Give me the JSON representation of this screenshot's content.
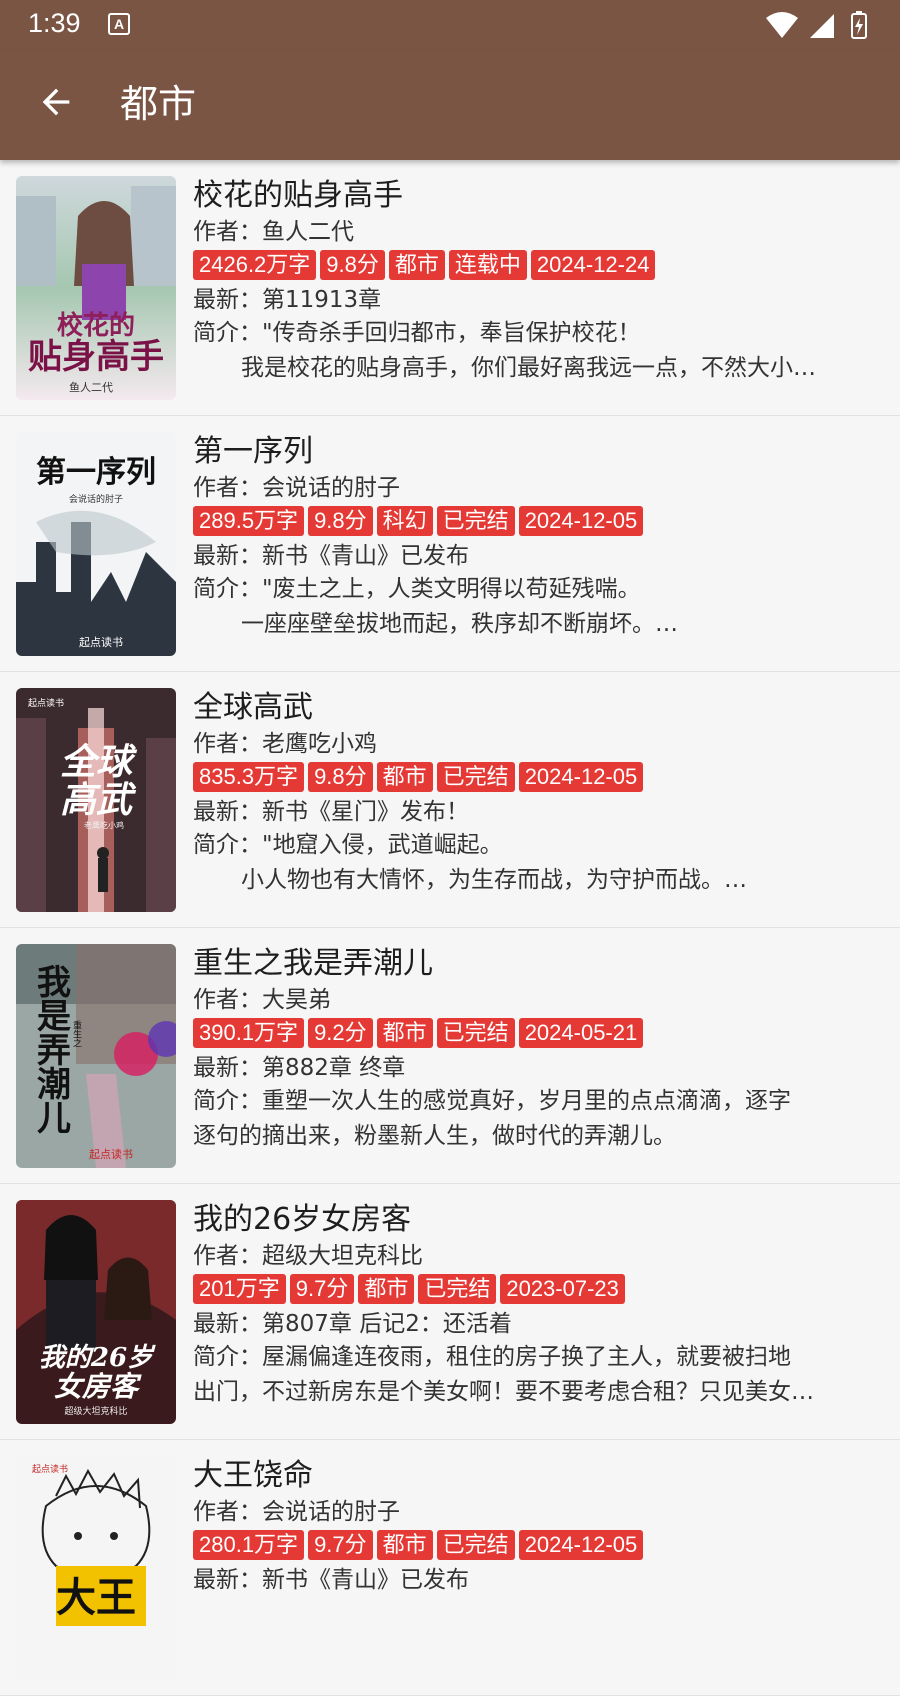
{
  "status_bar": {
    "time": "1:39",
    "notification_glyph": "A"
  },
  "app_bar": {
    "title": "都市",
    "back_icon": "arrow-back-icon"
  },
  "books": [
    {
      "title": "校花的贴身高手",
      "author": "作者：鱼人二代",
      "tags": [
        "2426.2万字",
        "9.8分",
        "都市",
        "连载中",
        "2024-12-24"
      ],
      "latest": "最新：第11913章",
      "desc_line1": "简介：\"传奇杀手回归都市，奉旨保护校花！",
      "desc_line2": "我是校花的贴身高手，你们最好离我远一点，不然大小…",
      "desc_indent": true,
      "cover_text": "校花的贴身高手",
      "cover_author": "鱼人二代"
    },
    {
      "title": "第一序列",
      "author": "作者：会说话的肘子",
      "tags": [
        "289.5万字",
        "9.8分",
        "科幻",
        "已完结",
        "2024-12-05"
      ],
      "latest": "最新：新书《青山》已发布",
      "desc_line1": "简介：\"废土之上，人类文明得以苟延残喘。",
      "desc_line2": "一座座壁垒拔地而起，秩序却不断崩坏。…",
      "desc_indent": true,
      "cover_text": "第一序列",
      "cover_author": "会说话的肘子",
      "cover_publisher": "起点读书"
    },
    {
      "title": "全球高武",
      "author": "作者：老鹰吃小鸡",
      "tags": [
        "835.3万字",
        "9.8分",
        "都市",
        "已完结",
        "2024-12-05"
      ],
      "latest": "最新：新书《星门》发布！",
      "desc_line1": "简介：\"地窟入侵，武道崛起。",
      "desc_line2": "小人物也有大情怀，为生存而战，为守护而战。…",
      "desc_indent": true,
      "cover_text": "全球高武",
      "cover_author": "老鹰吃小鸡",
      "cover_publisher": "起点读书"
    },
    {
      "title": "重生之我是弄潮儿",
      "author": "作者：大昊弟",
      "tags": [
        "390.1万字",
        "9.2分",
        "都市",
        "已完结",
        "2024-05-21"
      ],
      "latest": "最新：第882章 终章",
      "desc_line1": "简介：重塑一次人生的感觉真好，岁月里的点点滴滴，逐字",
      "desc_line2": "逐句的摘出来，粉墨新人生，做时代的弄潮儿。",
      "desc_indent": false,
      "cover_text": "我是弄潮儿",
      "cover_prefix": "重生之",
      "cover_publisher": "起点读书"
    },
    {
      "title": "我的26岁女房客",
      "author": "作者：超级大坦克科比",
      "tags": [
        "201万字",
        "9.7分",
        "都市",
        "已完结",
        "2023-07-23"
      ],
      "latest": "最新：第807章 后记2：还活着",
      "desc_line1": "简介：屋漏偏逢连夜雨，租住的房子换了主人，就要被扫地",
      "desc_line2": "出门，不过新房东是个美女啊！要不要考虑合租？只见美女…",
      "desc_indent": false,
      "cover_text": "我的26岁女房客",
      "cover_author": "超级大坦克科比"
    },
    {
      "title": "大王饶命",
      "author": "作者：会说话的肘子",
      "tags": [
        "280.1万字",
        "9.7分",
        "都市",
        "已完结",
        "2024-12-05"
      ],
      "latest": "最新：新书《青山》已发布",
      "desc_line1": "",
      "desc_line2": "",
      "desc_indent": false,
      "cover_text": "大王",
      "cover_publisher": "起点读书"
    }
  ],
  "colors": {
    "app_bar": "#7b5544",
    "tag": "#e53935",
    "background": "#f6f6f6"
  }
}
